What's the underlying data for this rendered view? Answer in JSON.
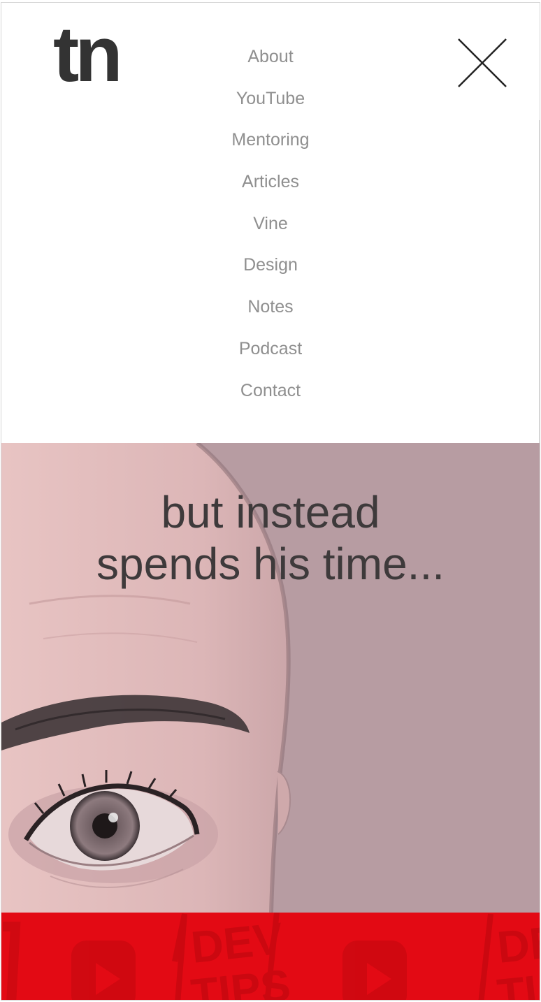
{
  "header": {
    "logo_text": "tn",
    "close_icon": "close-icon"
  },
  "nav": {
    "items": [
      {
        "label": "About"
      },
      {
        "label": "YouTube"
      },
      {
        "label": "Mentoring"
      },
      {
        "label": "Articles"
      },
      {
        "label": "Vine"
      },
      {
        "label": "Design"
      },
      {
        "label": "Notes"
      },
      {
        "label": "Podcast"
      },
      {
        "label": "Contact"
      }
    ]
  },
  "hero": {
    "line1": "but instead",
    "line2": "spends his time...",
    "image": "face-eye-photo"
  },
  "banner": {
    "watermark_text": "DEV TIPS",
    "icon": "play-button-icon",
    "color": "#e30a14"
  },
  "colors": {
    "logo": "#333333",
    "nav_link": "#8f8f8f",
    "hero_text": "#3e3a3b",
    "hero_tint": "#d9b2b4"
  }
}
